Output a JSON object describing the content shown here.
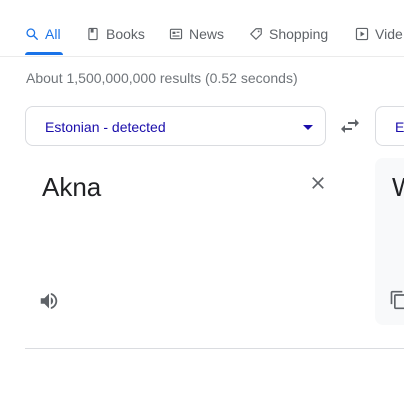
{
  "tabs": [
    {
      "label": "All",
      "icon": "search-icon",
      "active": true
    },
    {
      "label": "Books",
      "icon": "book-icon",
      "active": false
    },
    {
      "label": "News",
      "icon": "news-icon",
      "active": false
    },
    {
      "label": "Shopping",
      "icon": "tag-icon",
      "active": false
    },
    {
      "label": "Vide",
      "icon": "play-icon",
      "active": false
    }
  ],
  "result_stats": "About 1,500,000,000 results (0.52 seconds)",
  "translator": {
    "source_language": "Estonian - detected",
    "target_language": "E",
    "source_text": "Akna",
    "target_text": "W"
  },
  "colors": {
    "accent": "#1a73e8",
    "link": "#1a0dab",
    "muted": "#70757a",
    "icon_gray": "#5f6368"
  }
}
